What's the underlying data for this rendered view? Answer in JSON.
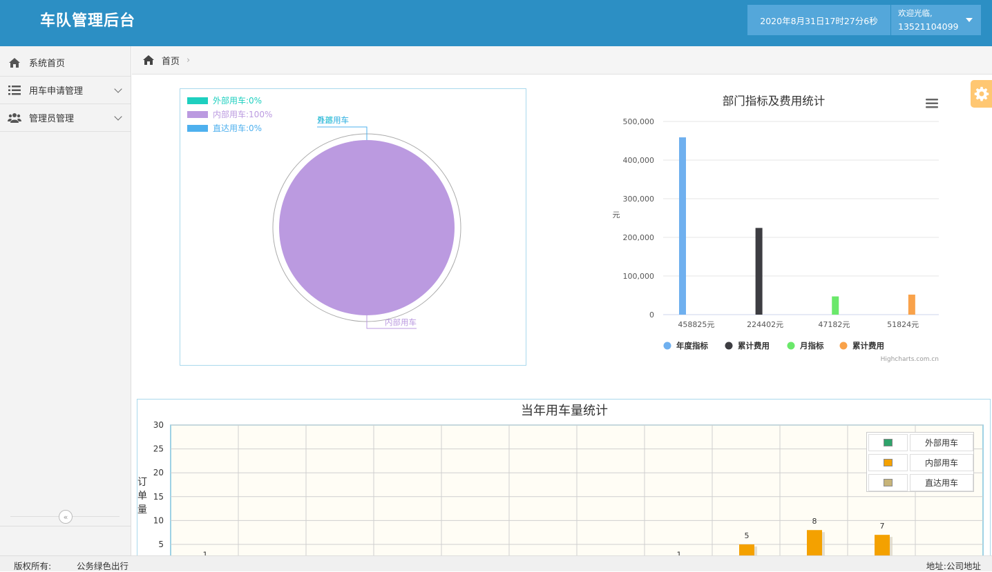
{
  "header": {
    "title": "车队管理后台",
    "datetime": "2020年8月31日17时27分6秒",
    "welcome": "欢迎光临,",
    "phone": "13521104099"
  },
  "sidebar": {
    "items": [
      {
        "label": "系统首页",
        "icon": "home-icon"
      },
      {
        "label": "用车申请管理",
        "icon": "list-icon",
        "expandable": true
      },
      {
        "label": "管理员管理",
        "icon": "users-icon",
        "expandable": true
      }
    ],
    "collapse_label": "«"
  },
  "breadcrumb": {
    "home": "首页",
    "separator": "›"
  },
  "colors": {
    "header_bg": "#2c8fc4",
    "external": "#1ecfbf",
    "internal": "#bb9ae0",
    "direct": "#4eb0ee"
  },
  "pie_chart": {
    "chart_data": {
      "type": "pie",
      "slices": [
        {
          "name": "外部用车",
          "value": 0,
          "legend": "外部用车:0%",
          "color": "#1ecfbf"
        },
        {
          "name": "内部用车",
          "value": 100,
          "legend": "内部用车:100%",
          "color": "#bb9ae0"
        },
        {
          "name": "直达用车",
          "value": 0,
          "legend": "直达用车:0%",
          "color": "#4eb0ee"
        }
      ],
      "top_labels": [
        "外部用车",
        "直达用车"
      ],
      "bottom_label": "内部用车"
    }
  },
  "bar_chart": {
    "chart_data": {
      "type": "bar",
      "title": "部门指标及费用统计",
      "ylabel": "元",
      "ylim": [
        0,
        500000
      ],
      "yticks": [
        "0",
        "100,000",
        "200,000",
        "300,000",
        "400,000",
        "500,000"
      ],
      "categories": [
        "458825元",
        "224402元",
        "47182元",
        "51824元"
      ],
      "series": [
        {
          "name": "年度指标",
          "color": "#6fb0ef",
          "values": [
            458825,
            null,
            null,
            null
          ]
        },
        {
          "name": "累计费用",
          "color": "#3d3d42",
          "values": [
            null,
            224402,
            null,
            null
          ]
        },
        {
          "name": "月指标",
          "color": "#6ae86a",
          "values": [
            null,
            null,
            47182,
            null
          ]
        },
        {
          "name": "累计费用",
          "color": "#f9a24a",
          "values": [
            null,
            null,
            null,
            51824
          ]
        }
      ],
      "credit": "Highcharts.com.cn"
    }
  },
  "bottom_chart": {
    "chart_data": {
      "type": "bar",
      "title": "当年用车量统计",
      "ylabel": "订单量",
      "ylim": [
        0,
        30
      ],
      "yticks": [
        "5",
        "10",
        "15",
        "20",
        "25",
        "30"
      ],
      "series": [
        {
          "name": "外部用车",
          "color": "#2fa36b"
        },
        {
          "name": "内部用车",
          "color": "#f4a100"
        },
        {
          "name": "直达用车",
          "color": "#c7b479"
        }
      ],
      "values_internal": [
        1,
        0,
        0,
        0,
        0,
        0,
        0,
        1,
        5,
        8,
        7,
        0
      ],
      "labels": [
        {
          "month_index": 0,
          "text": "1"
        },
        {
          "month_index": 7,
          "text": "1"
        },
        {
          "month_index": 8,
          "text": "5"
        },
        {
          "month_index": 9,
          "text": "8"
        },
        {
          "month_index": 10,
          "text": "7"
        }
      ]
    }
  },
  "footer": {
    "copyright_label": "版权所有:",
    "copyright_value": "公务绿色出行",
    "address": "地址:公司地址"
  }
}
